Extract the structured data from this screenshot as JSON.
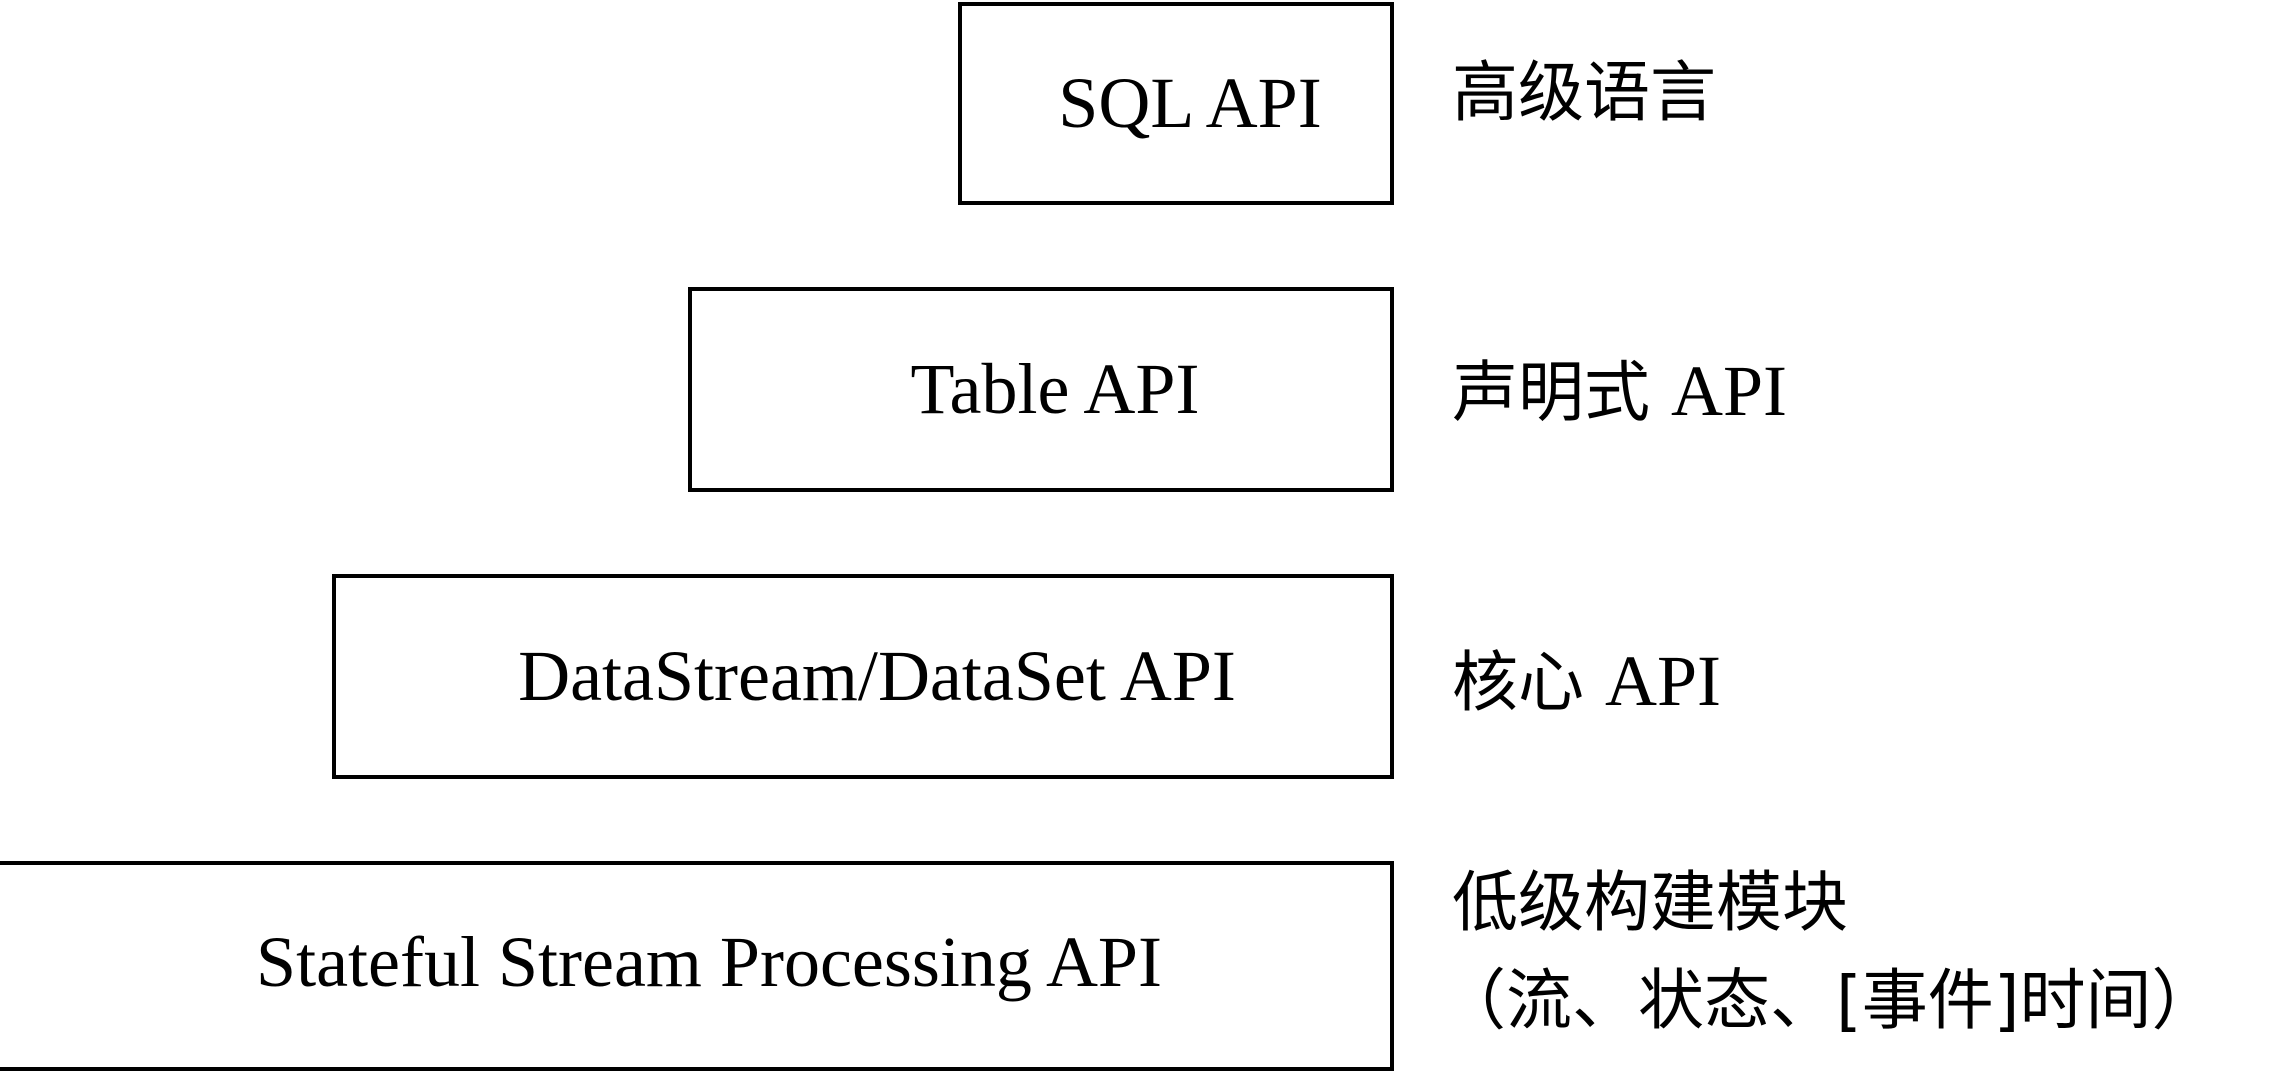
{
  "layers": [
    {
      "box": "SQL API",
      "label": "高级语言",
      "label_en": ""
    },
    {
      "box": "Table API",
      "label": "声明式 ",
      "label_en": "API"
    },
    {
      "box": "DataStream/DataSet API",
      "label": "核心 ",
      "label_en": "API"
    },
    {
      "box": "Stateful Stream Processing API",
      "label": "低级构建模块",
      "label_line2": "（流、状态、[事件]时间）"
    }
  ]
}
